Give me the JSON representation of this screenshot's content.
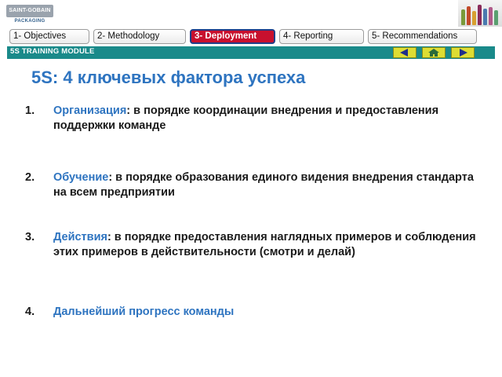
{
  "header": {
    "logo_line1": "SAINT-GOBAIN",
    "logo_line2": "PACKAGING"
  },
  "tabs": [
    {
      "label": "1- Objectives",
      "active": false
    },
    {
      "label": "2- Methodology",
      "active": false
    },
    {
      "label": "3- Deployment",
      "active": true
    },
    {
      "label": "4- Reporting",
      "active": false
    },
    {
      "label": "5- Recommendations",
      "active": false
    }
  ],
  "module_bar": {
    "label": "5S TRAINING MODULE",
    "prev_icon": "left-arrow-icon",
    "home_icon": "home-icon",
    "next_icon": "right-arrow-icon"
  },
  "colors": {
    "title": "#2e74c0",
    "module_bar": "#1a8a8a",
    "active_tab": "#c8102e",
    "nav_button": "#dddd33"
  },
  "slide": {
    "title": "5S: 4 ключевых фактора успеха",
    "items": [
      {
        "number": "1.",
        "key": "Организация",
        "text": ": в порядке координации внедрения и предоставления  поддержки команде"
      },
      {
        "number": "2.",
        "key": "Обучение",
        "text": ": в порядке образования единого видения внедрения стандарта на всем предприятии"
      },
      {
        "number": "3.",
        "key": "Действия",
        "text": ": в порядке предоставления наглядных примеров и соблюдения этих примеров в действительности (смотри и делай)"
      },
      {
        "number": "4.",
        "key": "Дальнейший прогресс команды",
        "text": ""
      }
    ]
  }
}
